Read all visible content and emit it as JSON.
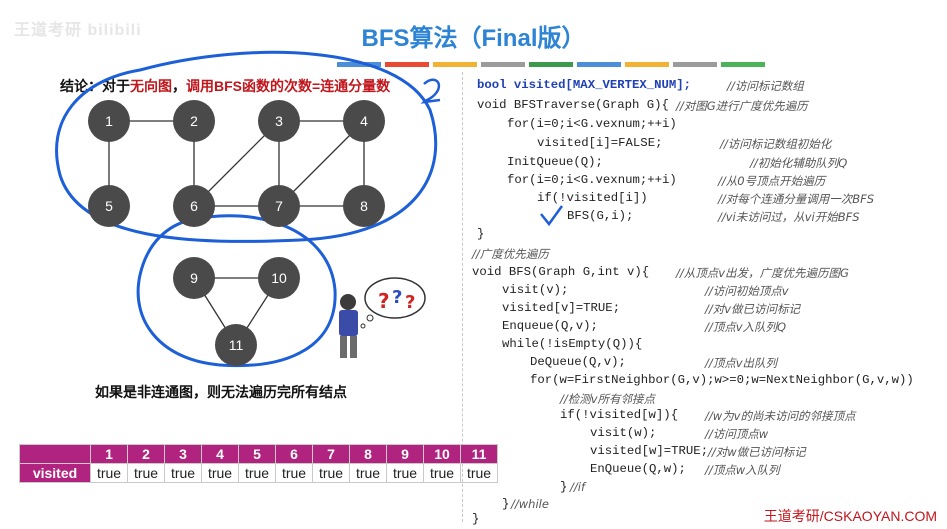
{
  "title": "BFS算法（Final版）",
  "watermark": "王道考研 bilibili",
  "conclusion": {
    "prefix": "结论：对于",
    "highlight1": "无向图",
    "mid": "，",
    "highlight2": "调用BFS函数的次数=连通分量数",
    "annotation": "2"
  },
  "note": "如果是非连通图，则无法遍历完所有结点",
  "graph": {
    "nodes": [
      "1",
      "2",
      "3",
      "4",
      "5",
      "6",
      "7",
      "8",
      "9",
      "10",
      "11"
    ]
  },
  "colors": {
    "accent": "#2e84d4",
    "node_fill": "#4a4a4a",
    "ink": "#1d5fd6",
    "table_header": "#b0247f",
    "highlight": "#c0161c",
    "color_bar": [
      "#4c8fd8",
      "#e84a33",
      "#f2b233",
      "#9b9b9b",
      "#3c9a4d",
      "#4c8fd8",
      "#f2b233",
      "#9b9b9b",
      "#4cb35a"
    ]
  },
  "code": {
    "l1": "bool visited[MAX_VERTEX_NUM];",
    "c1": "//访问标记数组",
    "l2": "void BFSTraverse(Graph G){",
    "c2": "//对图G进行广度优先遍历",
    "l3": "for(i=0;i<G.vexnum;++i)",
    "l4": "visited[i]=FALSE;",
    "c4": "//访问标记数组初始化",
    "l5": "InitQueue(Q);",
    "c5": "//初始化辅助队列Q",
    "l6": "for(i=0;i<G.vexnum;++i)",
    "c6": "//从0号顶点开始遍历",
    "l7": "if(!visited[i])",
    "c7": "//对每个连通分量调用一次BFS",
    "l8": "BFS(G,i);",
    "c8": "//vi未访问过，从vi开始BFS",
    "l9": "}",
    "c10": "//广度优先遍历",
    "l11": "void BFS(Graph G,int v){",
    "c11": "//从顶点v出发，广度优先遍历图G",
    "l12": "visit(v);",
    "c12": "//访问初始顶点v",
    "l13": "visited[v]=TRUE;",
    "c13": "//对v做已访问标记",
    "l14": "Enqueue(Q,v);",
    "c14": "//顶点v入队列Q",
    "l15": "while(!isEmpty(Q)){",
    "l16": "DeQueue(Q,v);",
    "c16": "//顶点v出队列",
    "l17": "for(w=FirstNeighbor(G,v);w>=0;w=NextNeighbor(G,v,w))",
    "c18": "//检测v所有邻接点",
    "l19": "if(!visited[w]){",
    "c19": "//w为v的尚未访问的邻接顶点",
    "l20": "visit(w);",
    "c20": "//访问顶点w",
    "l21": "visited[w]=TRUE;",
    "c21": "//对w做已访问标记",
    "l22": "EnQueue(Q,w);",
    "c22": "//顶点w入队列",
    "l23": "}",
    "c23": "//if",
    "l24": "}",
    "c24": "//while",
    "l25": "}"
  },
  "table": {
    "row_label": "visited",
    "headers": [
      "1",
      "2",
      "3",
      "4",
      "5",
      "6",
      "7",
      "8",
      "9",
      "10",
      "11"
    ],
    "values": [
      "true",
      "true",
      "true",
      "true",
      "true",
      "true",
      "true",
      "true",
      "true",
      "true",
      "true"
    ]
  },
  "footer": "王道考研/CSKAOYAN.COM"
}
